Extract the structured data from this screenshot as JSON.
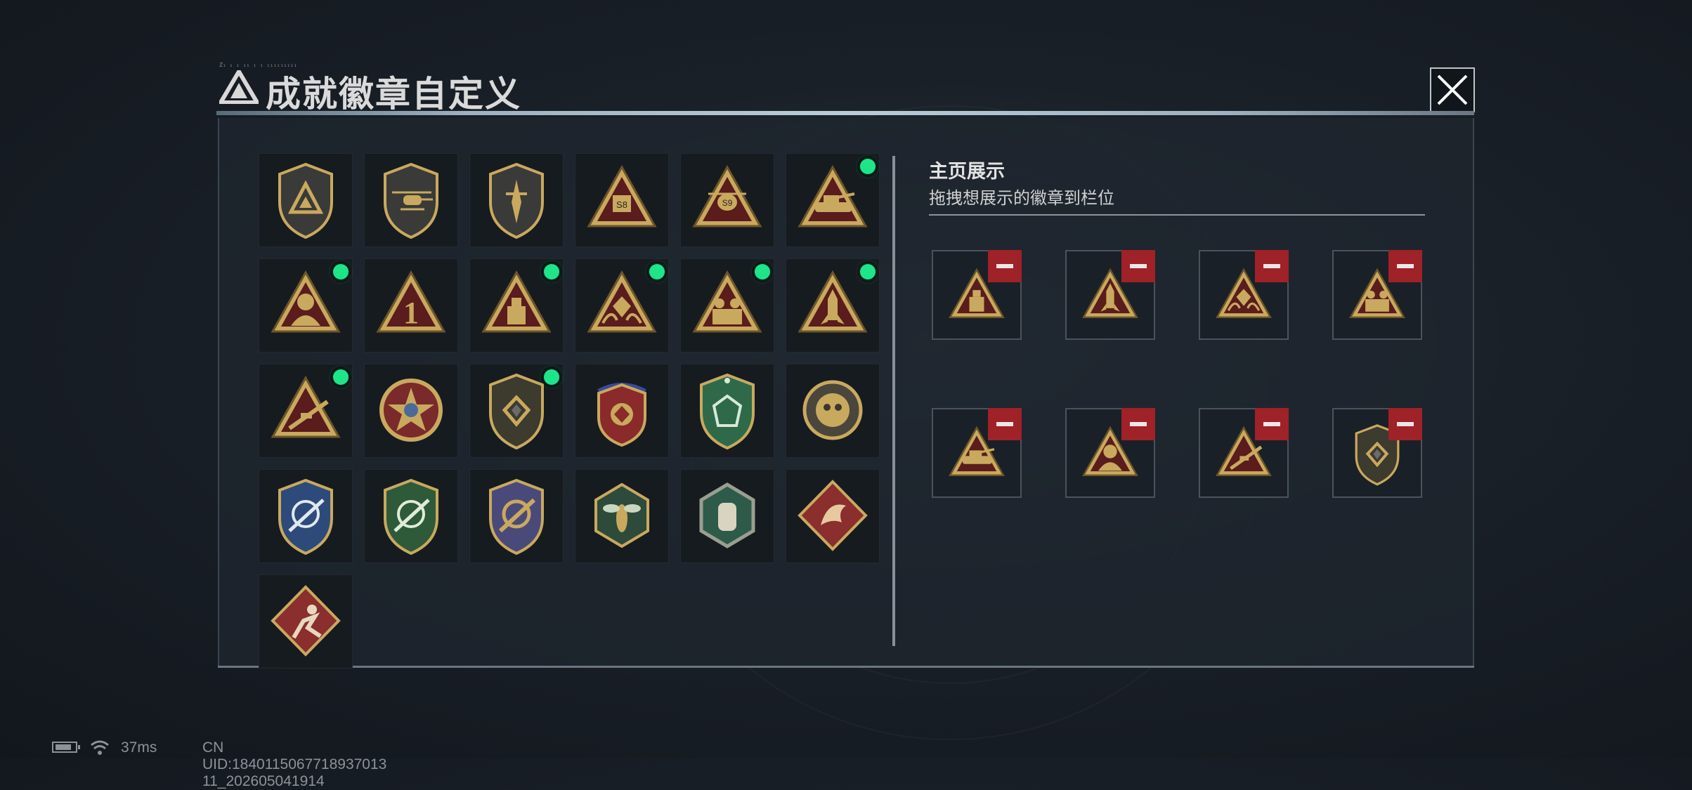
{
  "window": {
    "title": "成就徽章自定义",
    "title_tiny_text": "Z₁ ₁ ₁ ₁₁ ₁ ₁ ₁₁₁₁₁₁₁₁₁",
    "close_icon": "close-x-icon"
  },
  "badges": [
    {
      "icon": "shield-logo-badge",
      "new": false
    },
    {
      "icon": "shield-helicopter-badge",
      "new": false
    },
    {
      "icon": "shield-dagger-badge",
      "new": false
    },
    {
      "icon": "triangle-s8-badge",
      "label": "S8",
      "new": false
    },
    {
      "icon": "triangle-s9-badge",
      "label": "S9",
      "new": false
    },
    {
      "icon": "triangle-vehicle-badge",
      "new": true
    },
    {
      "icon": "triangle-soldier-badge",
      "new": true
    },
    {
      "icon": "triangle-number-one-badge",
      "label": "1",
      "new": false
    },
    {
      "icon": "triangle-usb-badge",
      "new": true
    },
    {
      "icon": "triangle-hands-diamond-badge",
      "new": true
    },
    {
      "icon": "triangle-squad-badge",
      "new": true
    },
    {
      "icon": "triangle-rocket-badge",
      "new": true
    },
    {
      "icon": "triangle-sniper-badge",
      "new": true
    },
    {
      "icon": "round-star-badge",
      "new": false
    },
    {
      "icon": "shield-diamond-badge",
      "new": true
    },
    {
      "icon": "crest-stars-badge",
      "new": false
    },
    {
      "icon": "green-gem-badge",
      "new": false
    },
    {
      "icon": "round-skull-badge",
      "new": false
    },
    {
      "icon": "blue-rifle-crest-badge",
      "new": false
    },
    {
      "icon": "green-rifle-crest-badge",
      "new": false
    },
    {
      "icon": "gold-rifle-crest-badge",
      "new": false
    },
    {
      "icon": "hexagon-wasp-badge",
      "new": false
    },
    {
      "icon": "hexagon-fist-badge",
      "new": false
    },
    {
      "icon": "diamond-dragon-badge",
      "new": false
    },
    {
      "icon": "diamond-runner-badge",
      "new": false
    }
  ],
  "showcase": {
    "title": "主页展示",
    "subtitle": "拖拽想展示的徽章到栏位",
    "slots": [
      {
        "icon": "triangle-usb-badge",
        "remove_icon": "minus-icon"
      },
      {
        "icon": "triangle-rocket-badge",
        "remove_icon": "minus-icon"
      },
      {
        "icon": "triangle-hands-diamond-badge",
        "remove_icon": "minus-icon"
      },
      {
        "icon": "triangle-squad-badge",
        "remove_icon": "minus-icon"
      },
      {
        "icon": "triangle-vehicle-badge",
        "remove_icon": "minus-icon"
      },
      {
        "icon": "triangle-soldier-badge",
        "remove_icon": "minus-icon"
      },
      {
        "icon": "triangle-sniper-badge",
        "remove_icon": "minus-icon"
      },
      {
        "icon": "shield-diamond-badge",
        "remove_icon": "minus-icon"
      }
    ]
  },
  "status_bar": {
    "latency": "37ms",
    "uid": "CN UID:1840115067718937013​11_202605041914"
  },
  "colors": {
    "gold": "#c9a95e",
    "dark_red": "#5a1a1a",
    "new_dot": "#1ee58a",
    "remove_red": "#9e2228"
  }
}
